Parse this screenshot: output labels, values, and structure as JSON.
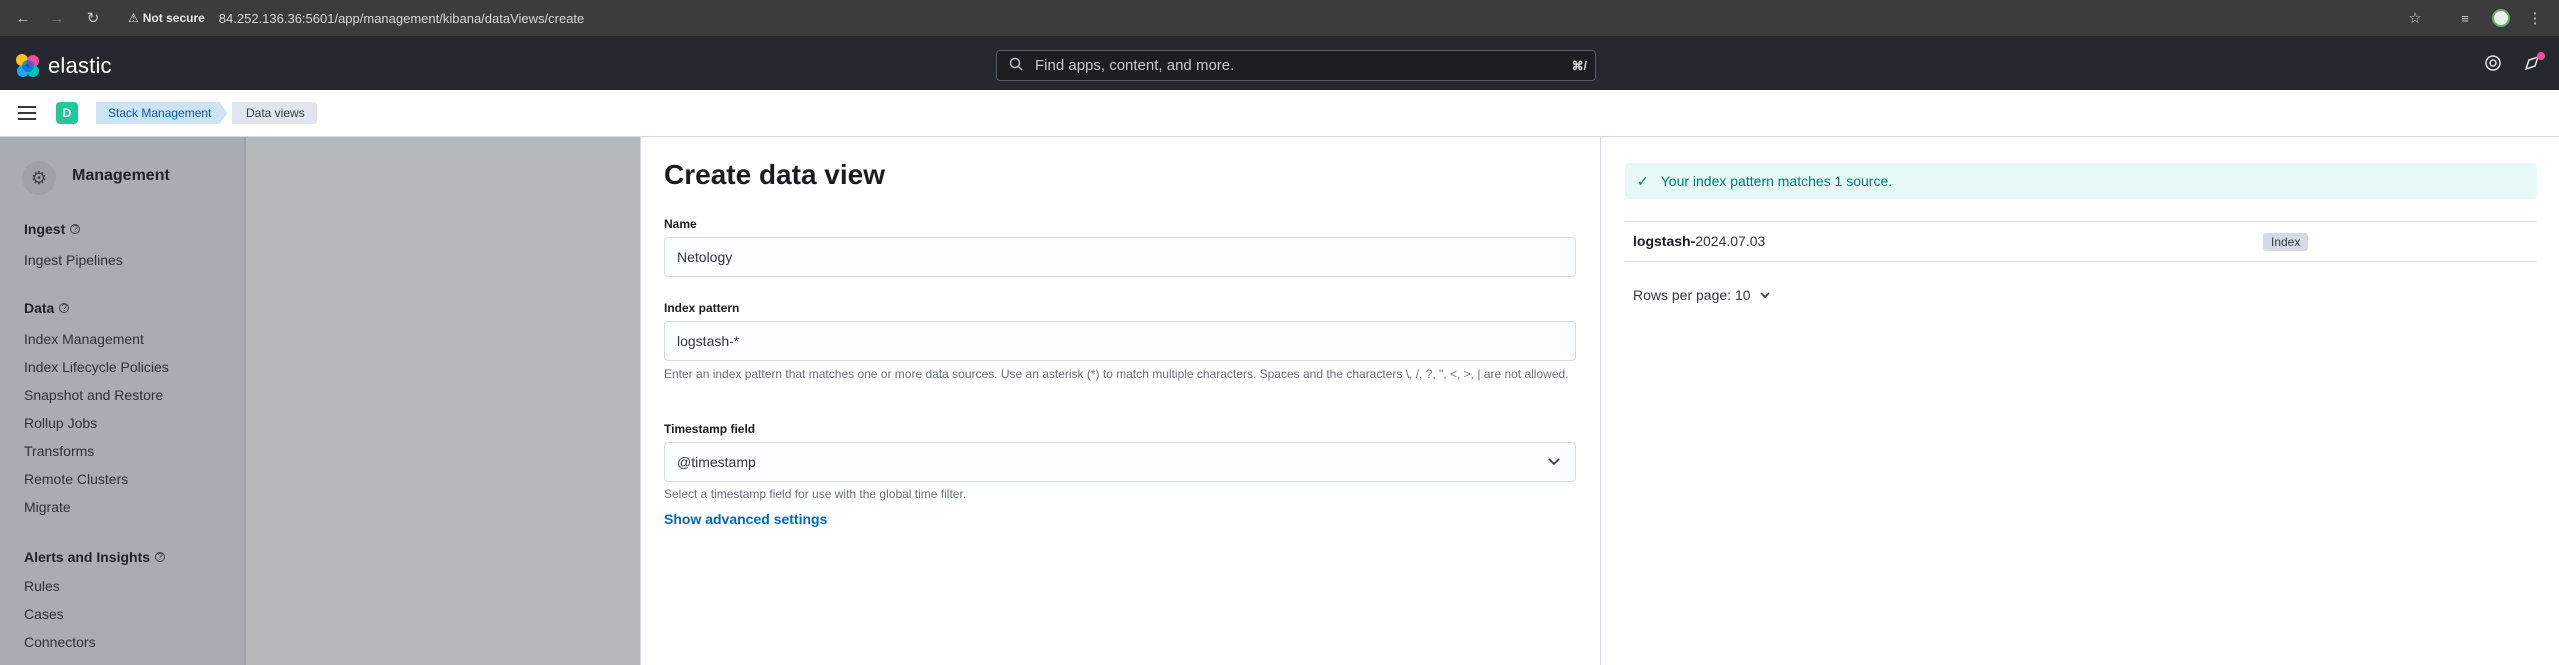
{
  "browser": {
    "security_label": "Not secure",
    "url": "84.252.136.36:5601/app/management/kibana/dataViews/create"
  },
  "header": {
    "logo_text": "elastic",
    "search_placeholder": "Find apps, content, and more.",
    "search_shortcut": "⌘/"
  },
  "breadcrumbs": {
    "space_initial": "D",
    "items": [
      "Stack Management",
      "Data views"
    ]
  },
  "sidebar": {
    "title": "Management",
    "sections": [
      {
        "title": "Ingest",
        "items": [
          "Ingest Pipelines"
        ]
      },
      {
        "title": "Data",
        "items": [
          "Index Management",
          "Index Lifecycle Policies",
          "Snapshot and Restore",
          "Rollup Jobs",
          "Transforms",
          "Remote Clusters",
          "Migrate"
        ]
      },
      {
        "title": "Alerts and Insights",
        "items": [
          "Rules",
          "Cases",
          "Connectors"
        ]
      }
    ]
  },
  "form": {
    "title": "Create data view",
    "name_label": "Name",
    "name_value": "Netology",
    "index_pattern_label": "Index pattern",
    "index_pattern_value": "logstash-*",
    "index_pattern_help": "Enter an index pattern that matches one or more data sources. Use an asterisk (*) to match multiple characters. Spaces and the characters \\, /, ?, \", <, >, | are not allowed.",
    "timestamp_label": "Timestamp field",
    "timestamp_value": "@timestamp",
    "timestamp_help": "Select a timestamp field for use with the global time filter.",
    "advanced_link": "Show advanced settings"
  },
  "results": {
    "callout": "Your index pattern matches 1 source.",
    "rows": [
      {
        "name_bold": "logstash-",
        "name_rest": "2024.07.03",
        "type": "Index"
      }
    ],
    "rows_per_page": "Rows per page: 10"
  },
  "colors": {
    "header_bg": "#25282f",
    "accent_link": "#006bb8",
    "success_text": "#017d73",
    "success_bg": "#e6f9f7"
  }
}
